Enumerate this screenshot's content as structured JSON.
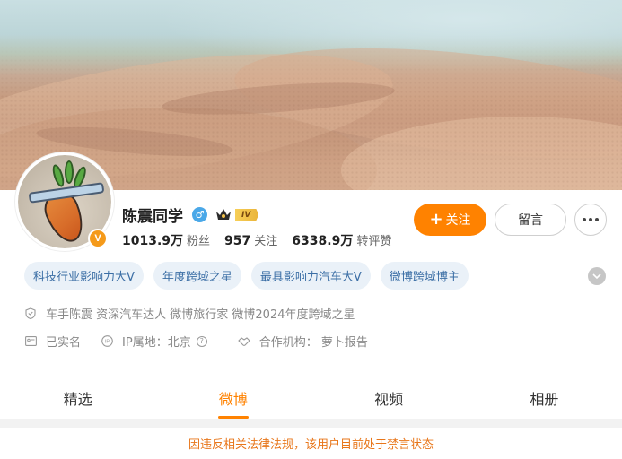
{
  "profile": {
    "name": "陈震同学",
    "level_badge": "IV",
    "verified_badge": "V",
    "stats": [
      {
        "num": "1013.9万",
        "label": "粉丝"
      },
      {
        "num": "957",
        "label": "关注"
      },
      {
        "num": "6338.9万",
        "label": "转评赞"
      }
    ]
  },
  "actions": {
    "follow_label": "关注",
    "follow_plus": "+",
    "message_label": "留言"
  },
  "tags": [
    "科技行业影响力大V",
    "年度跨域之星",
    "最具影响力汽车大V",
    "微博跨域博主"
  ],
  "info": {
    "bio": "车手陈震 资深汽车达人 微博旅行家 微博2024年度跨域之星",
    "real_name": "已实名",
    "ip_location": "IP属地：北京",
    "cooperation": "合作机构：  萝卜报告"
  },
  "tabs": [
    {
      "label": "精选",
      "active": false
    },
    {
      "label": "微博",
      "active": true
    },
    {
      "label": "视频",
      "active": false
    },
    {
      "label": "相册",
      "active": false
    }
  ],
  "notice": "因违反相关法律法规，该用户目前处于禁言状态",
  "colors": {
    "accent": "#ff8200",
    "tag_bg": "#eaf1f8",
    "tag_text": "#3b6ea5",
    "gender": "#4aa8e8"
  }
}
